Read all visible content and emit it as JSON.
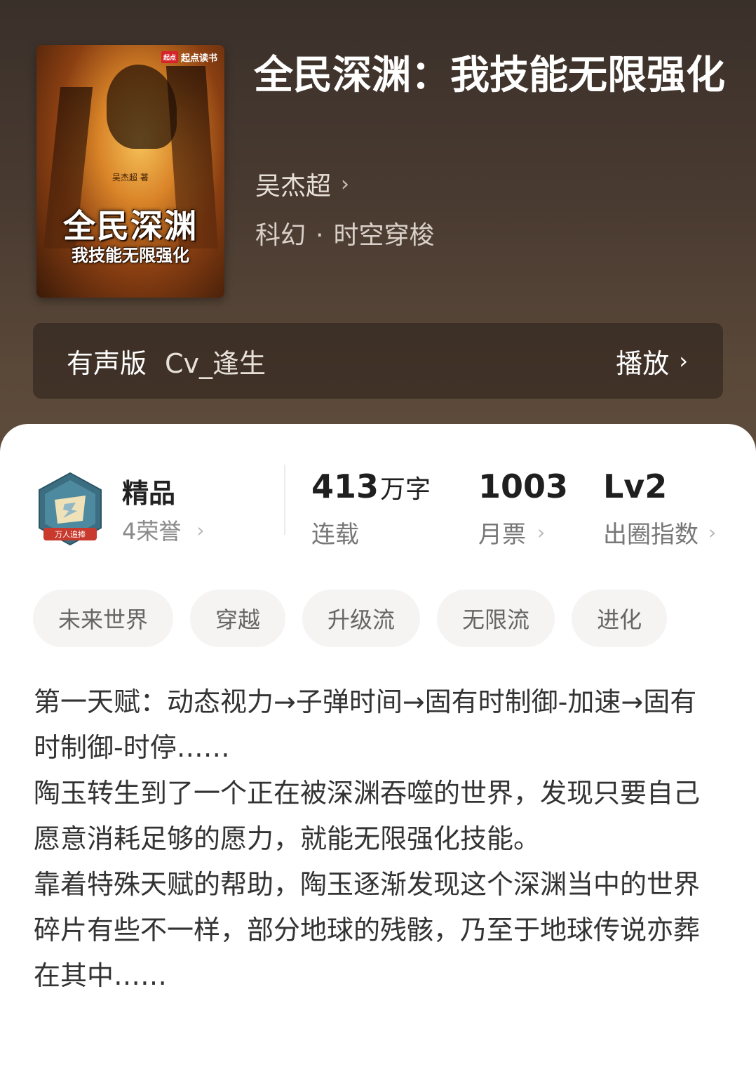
{
  "cover": {
    "publisher_logo": "起点",
    "publisher": "起点读书",
    "author_small": "吴杰超 著",
    "title_line1": "全民深渊",
    "title_line2": "我技能无限强化"
  },
  "book": {
    "title": "全民深渊：我技能无限强化",
    "author": "吴杰超",
    "genre": "科幻",
    "subgenre": "时空穿梭",
    "separator": "·"
  },
  "audio": {
    "label": "有声版",
    "cv": "Cv_逢生",
    "play_label": "播放"
  },
  "honor": {
    "badge_text": "万人追捧",
    "title": "精品",
    "subtitle": "4荣誉"
  },
  "stats": {
    "words_value": "413",
    "words_unit": "万字",
    "words_label": "连载",
    "tickets_value": "1003",
    "tickets_label": "月票",
    "index_value": "Lv2",
    "index_label": "出圈指数"
  },
  "tags": [
    "未来世界",
    "穿越",
    "升级流",
    "无限流",
    "进化"
  ],
  "description": [
    "第一天赋：动态视力→子弹时间→固有时制御-加速→固有时制御-时停……",
    "陶玉转生到了一个正在被深渊吞噬的世界，发现只要自己愿意消耗足够的愿力，就能无限强化技能。",
    "靠着特殊天赋的帮助，陶玉逐渐发现这个深渊当中的世界碎片有些不一样，部分地球的残骸，乃至于地球传说亦葬在其中……"
  ],
  "icons": {
    "author_chevron": "chevron-right-icon",
    "play_chevron": "chevron-right-icon",
    "honor_badge": "honor-badge-icon"
  }
}
